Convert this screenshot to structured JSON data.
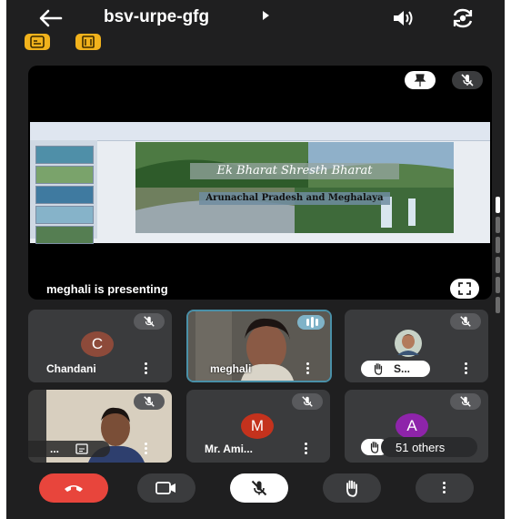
{
  "meeting": {
    "code": "bsv-urpe-gfg"
  },
  "presentation": {
    "presenter_label": "meghali is presenting",
    "slide": {
      "title": "Ek Bharat Shresth Bharat",
      "subtitle": "Arunachal Pradesh and Meghalaya"
    }
  },
  "participants": [
    {
      "name": "Chandani",
      "initial": "C",
      "avatar_color": "#8d4a3a",
      "muted": true
    },
    {
      "name": "meghali",
      "video": true,
      "speaking": true
    },
    {
      "name": "S...",
      "video": true,
      "muted": true,
      "hand_raised": true
    },
    {
      "name": "...",
      "video": true,
      "muted": true
    },
    {
      "name": "Mr. Ami...",
      "initial": "M",
      "avatar_color": "#c4321d",
      "muted": true
    },
    {
      "name": "A",
      "initial": "A",
      "avatar_color": "#8e24aa",
      "muted": true
    }
  ],
  "others": {
    "label": "51 others"
  },
  "colors": {
    "background": "#1f1f20",
    "tile": "#3a3b3d",
    "end_call": "#e8453c",
    "badge": "#f1b21c",
    "active_border": "#4a90a8"
  },
  "icons": [
    "back-arrow-icon",
    "speaker-icon",
    "switch-camera-icon",
    "captions-badge-icon",
    "translate-badge-icon",
    "pin-icon",
    "mic-off-icon",
    "fullscreen-icon",
    "more-vert-icon",
    "hand-raise-icon",
    "end-call-icon",
    "camera-icon"
  ]
}
